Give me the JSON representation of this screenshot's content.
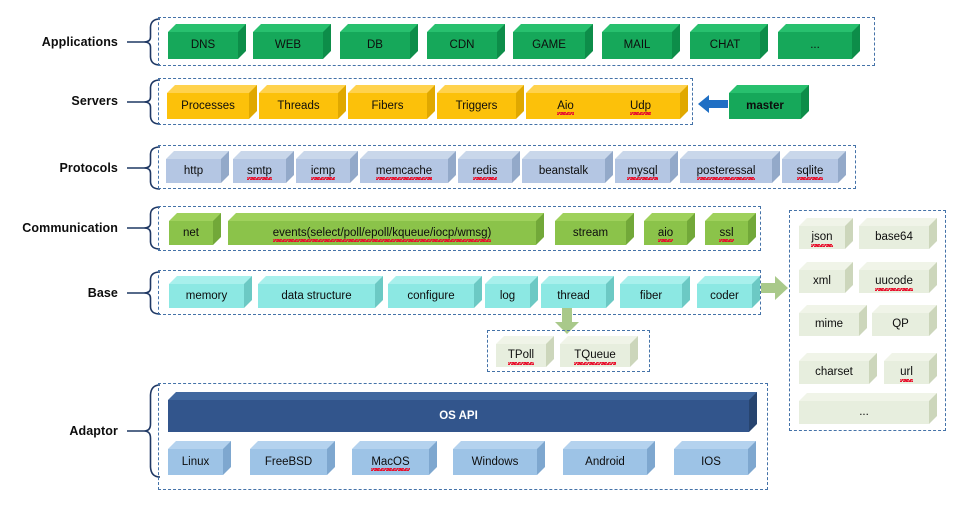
{
  "diagram": {
    "title": "Layered server framework architecture",
    "colors": {
      "applications": "#16a85a",
      "servers": "#fcc10a",
      "protocols": "#b4c6e3",
      "communication": "#8bc34a",
      "base": "#8ce8e3",
      "coder": "#e7eede",
      "os_api": "#32558c",
      "platforms": "#9dc3e6",
      "frame_border": "#4472a8",
      "arrow_blue": "#1f6fc4",
      "arrow_green": "#a9c98a"
    },
    "rows": [
      {
        "label": "Applications",
        "name": "applications",
        "items": [
          {
            "text": "DNS",
            "squiggle": false
          },
          {
            "text": "WEB",
            "squiggle": false
          },
          {
            "text": "DB",
            "squiggle": false
          },
          {
            "text": "CDN",
            "squiggle": false
          },
          {
            "text": "GAME",
            "squiggle": false
          },
          {
            "text": "MAIL",
            "squiggle": false
          },
          {
            "text": "CHAT",
            "squiggle": false
          },
          {
            "text": "...",
            "squiggle": false
          }
        ]
      },
      {
        "label": "Servers",
        "name": "servers",
        "items": [
          {
            "text": "Processes",
            "squiggle": false
          },
          {
            "text": "Threads",
            "squiggle": false
          },
          {
            "text": "Fibers",
            "squiggle": false
          },
          {
            "text": "Triggers",
            "squiggle": false
          },
          {
            "text": "Aio",
            "squiggle": true
          },
          {
            "text": "Udp",
            "squiggle": true
          }
        ]
      },
      {
        "label": "Protocols",
        "name": "protocols",
        "items": [
          {
            "text": "http",
            "squiggle": false
          },
          {
            "text": "smtp",
            "squiggle": true
          },
          {
            "text": "icmp",
            "squiggle": true
          },
          {
            "text": "memcache",
            "squiggle": true
          },
          {
            "text": "redis",
            "squiggle": true
          },
          {
            "text": "beanstalk",
            "squiggle": false
          },
          {
            "text": "mysql",
            "squiggle": true
          },
          {
            "text": "posteressal",
            "squiggle": true
          },
          {
            "text": "sqlite",
            "squiggle": true
          }
        ]
      },
      {
        "label": "Communication",
        "name": "communication",
        "items": [
          {
            "text": "net",
            "squiggle": false
          },
          {
            "text": "events(select/poll/epoll/kqueue/iocp/wmsg)",
            "squiggle": true
          },
          {
            "text": "stream",
            "squiggle": false
          },
          {
            "text": "aio",
            "squiggle": true
          },
          {
            "text": "ssl",
            "squiggle": true
          }
        ]
      },
      {
        "label": "Base",
        "name": "base",
        "items": [
          {
            "text": "memory",
            "squiggle": false
          },
          {
            "text": "data structure",
            "squiggle": false
          },
          {
            "text": "configure",
            "squiggle": false
          },
          {
            "text": "log",
            "squiggle": false
          },
          {
            "text": "thread",
            "squiggle": false
          },
          {
            "text": "fiber",
            "squiggle": false
          },
          {
            "text": "coder",
            "squiggle": false
          }
        ]
      },
      {
        "label": "Adaptor",
        "name": "adaptor",
        "items": []
      }
    ],
    "thread_detail": {
      "name": "thread-detail",
      "items": [
        {
          "text": "TPoll",
          "squiggle": true
        },
        {
          "text": "TQueue",
          "squiggle": true
        }
      ]
    },
    "coder_detail": {
      "name": "coder-detail",
      "items": [
        {
          "text": "json",
          "squiggle": true
        },
        {
          "text": "base64",
          "squiggle": false
        },
        {
          "text": "xml",
          "squiggle": false
        },
        {
          "text": "uucode",
          "squiggle": true
        },
        {
          "text": "mime",
          "squiggle": false
        },
        {
          "text": "QP",
          "squiggle": false
        },
        {
          "text": "charset",
          "squiggle": false
        },
        {
          "text": "url",
          "squiggle": true
        },
        {
          "text": "...",
          "squiggle": false
        }
      ]
    },
    "master": {
      "text": "master"
    },
    "adaptor": {
      "os_api": {
        "text": "OS API"
      },
      "platforms": [
        {
          "text": "Linux",
          "squiggle": false
        },
        {
          "text": "FreeBSD",
          "squiggle": false
        },
        {
          "text": "MacOS",
          "squiggle": true
        },
        {
          "text": "Windows",
          "squiggle": false
        },
        {
          "text": "Android",
          "squiggle": false
        },
        {
          "text": "IOS",
          "squiggle": false
        }
      ]
    }
  }
}
